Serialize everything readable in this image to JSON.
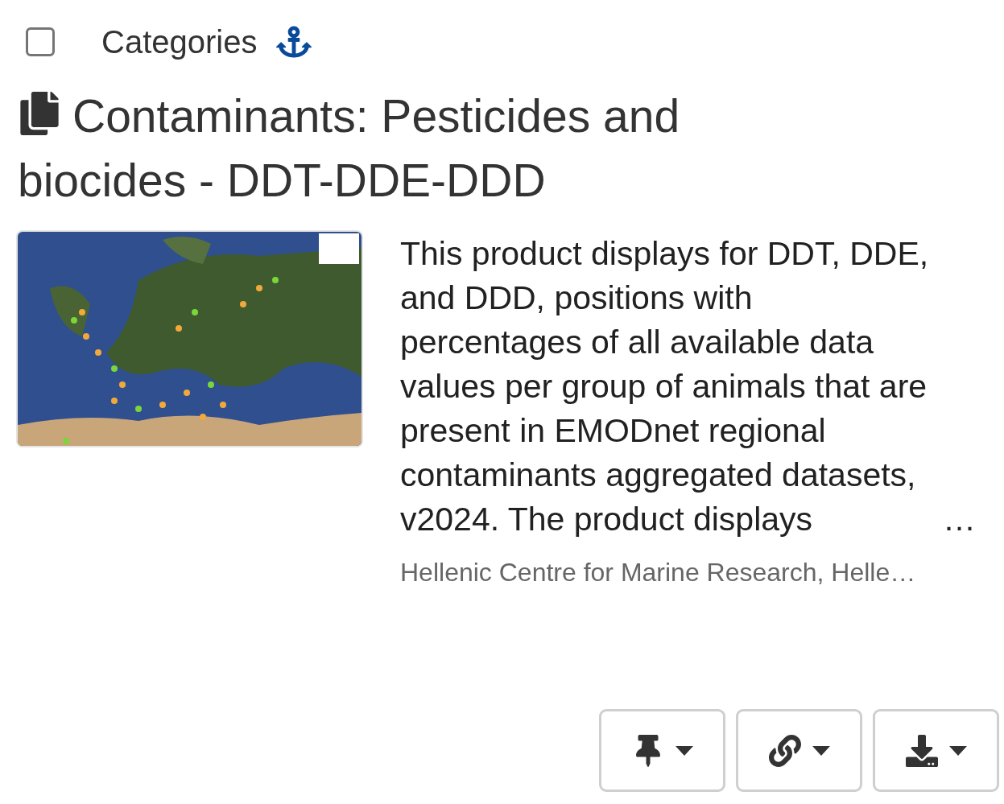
{
  "header": {
    "checkbox": {
      "checked": false
    },
    "label": "Categories"
  },
  "title": "Contaminants: Pesticides and biocides - DDT-DDE-DDD",
  "description": "This product displays for DDT, DDE, and DDD, positions with percentages of all available data values per group of animals that are present in EMODnet regional contaminants aggregated datasets, v2024. The product displays",
  "description_ellipsis": "…",
  "author": "Hellenic Centre for Marine Research, Helle…",
  "buttons": [
    {
      "kind": "pin"
    },
    {
      "kind": "link"
    },
    {
      "kind": "download"
    }
  ]
}
